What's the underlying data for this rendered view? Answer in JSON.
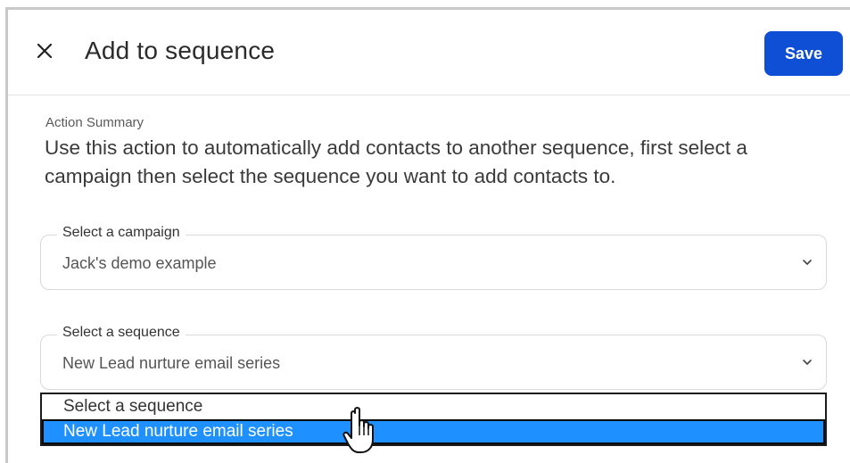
{
  "dialog": {
    "title": "Add to sequence",
    "close_icon": "close-icon",
    "save_label": "Save",
    "accent_color": "#0f4fd6"
  },
  "summary": {
    "label": "Action Summary",
    "text": "Use this action to automatically add contacts to another sequence, first select a campaign then select the sequence you want to add contacts to."
  },
  "campaign_select": {
    "label": "Select a campaign",
    "value": "Jack's demo example",
    "icon": "chevron-down-icon"
  },
  "sequence_select": {
    "label": "Select a sequence",
    "value": "New Lead nurture email series",
    "icon": "chevron-down-icon",
    "options": [
      {
        "label": "Select a sequence",
        "selected": false
      },
      {
        "label": "New Lead nurture email series",
        "selected": true
      }
    ],
    "highlight_color": "#1e90ff"
  },
  "pointer": {
    "icon": "hand-pointer-icon"
  }
}
